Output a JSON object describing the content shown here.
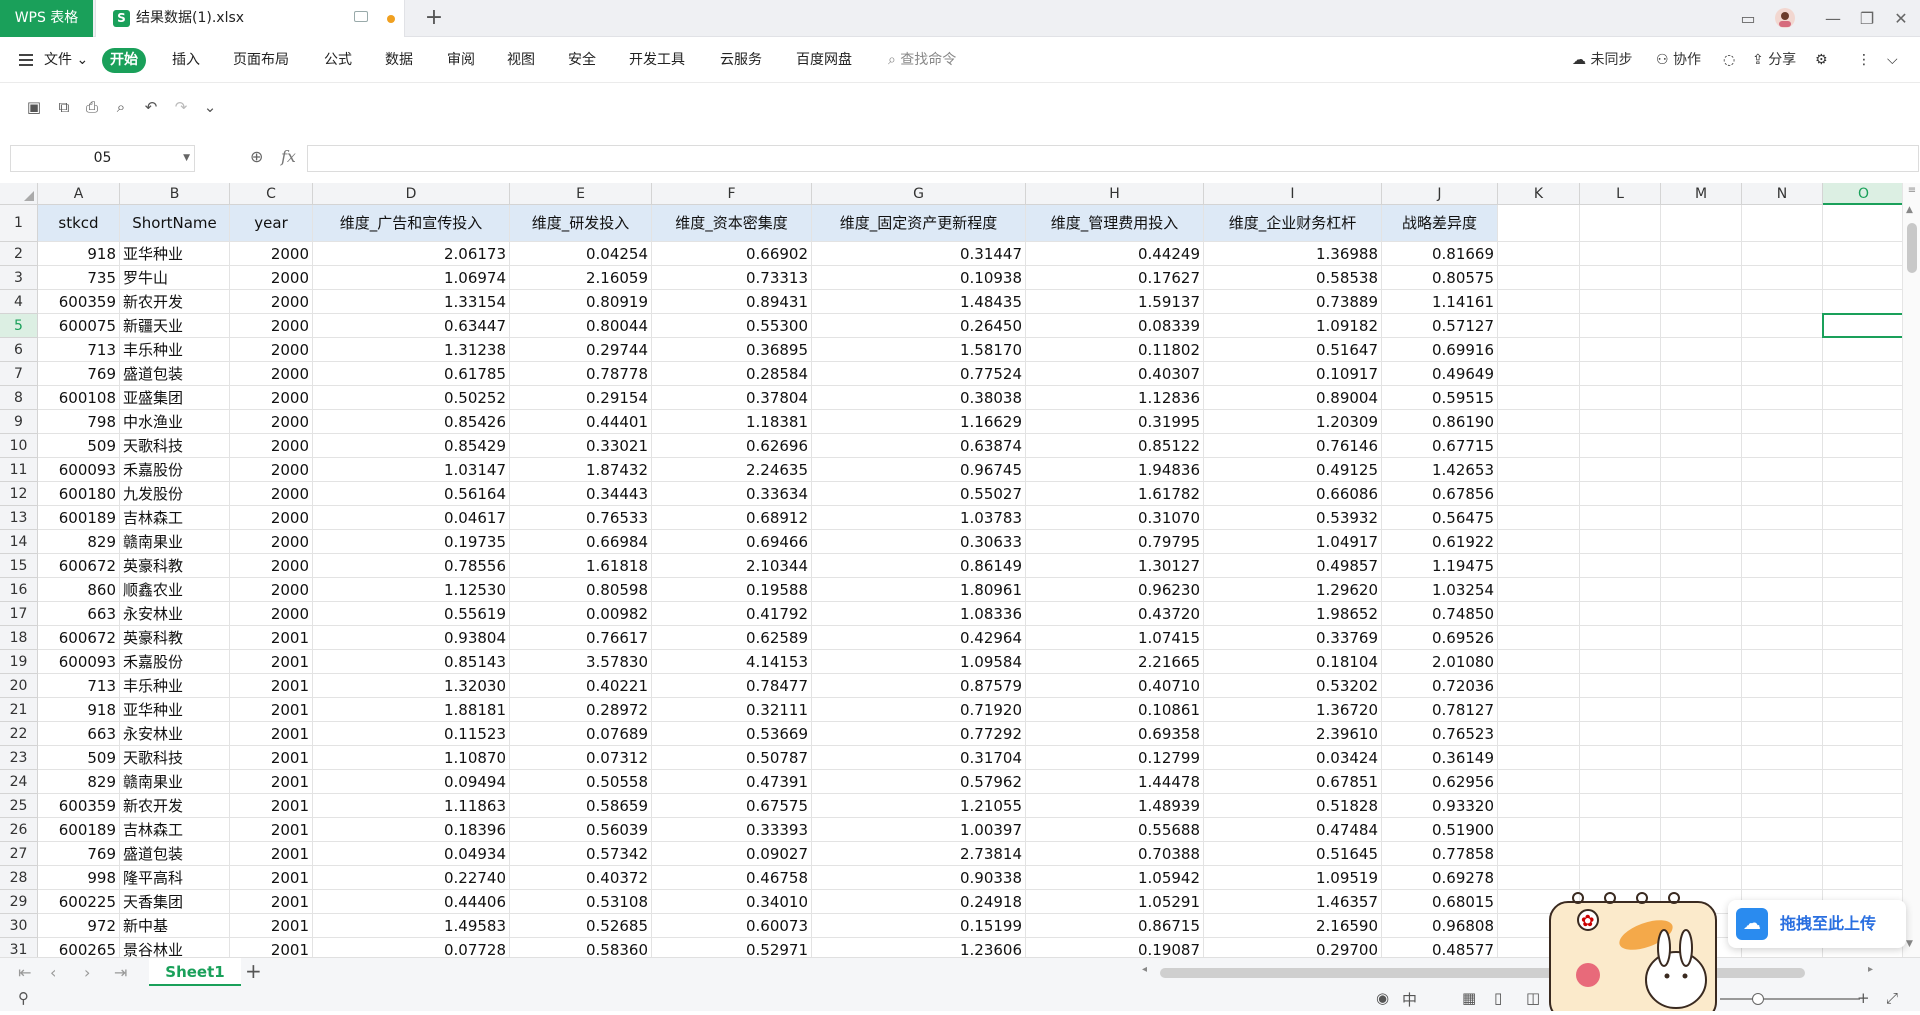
{
  "titlebar": {
    "app_name": "WPS 表格",
    "doc_icon": "S",
    "doc_name": "结果数据(1).xlsx",
    "new_tab": "+",
    "window_controls": [
      "minimize-icon",
      "restore-icon",
      "close-icon"
    ]
  },
  "menu": {
    "file": "文件",
    "active": "开始",
    "items": [
      "插入",
      "页面布局",
      "公式",
      "数据",
      "审阅",
      "视图",
      "安全",
      "开发工具",
      "云服务",
      "百度网盘"
    ],
    "search": "查找命令",
    "sync": "未同步",
    "collab": "协作",
    "share": "分享"
  },
  "quickbar": {
    "icons": [
      "save-icon",
      "save-as-icon",
      "print-icon",
      "print-preview-icon",
      "undo-icon",
      "redo-icon",
      "customize-icon"
    ]
  },
  "formula": {
    "namebox": "05",
    "fx": "fx",
    "value": ""
  },
  "sheet": {
    "columns": [
      "A",
      "B",
      "C",
      "D",
      "E",
      "F",
      "G",
      "H",
      "I",
      "J",
      "K",
      "L",
      "M",
      "N",
      "O"
    ],
    "selected_column": "O",
    "selected_row": "5",
    "header_row": [
      "stkcd",
      "ShortName",
      "year",
      "维度_广告和宣传投入",
      "维度_研发投入",
      "维度_资本密集度",
      "维度_固定资产更新程度",
      "维度_管理费用投入",
      "维度_企业财务杠杆",
      "战略差异度"
    ],
    "rows": [
      [
        "2",
        "918",
        "亚华种业",
        "2000",
        "2.06173",
        "0.04254",
        "0.66902",
        "0.31447",
        "0.44249",
        "1.36988",
        "0.81669"
      ],
      [
        "3",
        "735",
        "罗牛山",
        "2000",
        "1.06974",
        "2.16059",
        "0.73313",
        "0.10938",
        "0.17627",
        "0.58538",
        "0.80575"
      ],
      [
        "4",
        "600359",
        "新农开发",
        "2000",
        "1.33154",
        "0.80919",
        "0.89431",
        "1.48435",
        "1.59137",
        "0.73889",
        "1.14161"
      ],
      [
        "5",
        "600075",
        "新疆天业",
        "2000",
        "0.63447",
        "0.80044",
        "0.55300",
        "0.26450",
        "0.08339",
        "1.09182",
        "0.57127"
      ],
      [
        "6",
        "713",
        "丰乐种业",
        "2000",
        "1.31238",
        "0.29744",
        "0.36895",
        "1.58170",
        "0.11802",
        "0.51647",
        "0.69916"
      ],
      [
        "7",
        "769",
        "盛道包装",
        "2000",
        "0.61785",
        "0.78778",
        "0.28584",
        "0.77524",
        "0.40307",
        "0.10917",
        "0.49649"
      ],
      [
        "8",
        "600108",
        "亚盛集团",
        "2000",
        "0.50252",
        "0.29154",
        "0.37804",
        "0.38038",
        "1.12836",
        "0.89004",
        "0.59515"
      ],
      [
        "9",
        "798",
        "中水渔业",
        "2000",
        "0.85426",
        "0.44401",
        "1.18381",
        "1.16629",
        "0.31995",
        "1.20309",
        "0.86190"
      ],
      [
        "10",
        "509",
        "天歌科技",
        "2000",
        "0.85429",
        "0.33021",
        "0.62696",
        "0.63874",
        "0.85122",
        "0.76146",
        "0.67715"
      ],
      [
        "11",
        "600093",
        "禾嘉股份",
        "2000",
        "1.03147",
        "1.87432",
        "2.24635",
        "0.96745",
        "1.94836",
        "0.49125",
        "1.42653"
      ],
      [
        "12",
        "600180",
        "九发股份",
        "2000",
        "0.56164",
        "0.34443",
        "0.33634",
        "0.55027",
        "1.61782",
        "0.66086",
        "0.67856"
      ],
      [
        "13",
        "600189",
        "吉林森工",
        "2000",
        "0.04617",
        "0.76533",
        "0.68912",
        "1.03783",
        "0.31070",
        "0.53932",
        "0.56475"
      ],
      [
        "14",
        "829",
        "赣南果业",
        "2000",
        "0.19735",
        "0.66984",
        "0.69466",
        "0.30633",
        "0.79795",
        "1.04917",
        "0.61922"
      ],
      [
        "15",
        "600672",
        "英豪科教",
        "2000",
        "0.78556",
        "1.61818",
        "2.10344",
        "0.86149",
        "1.30127",
        "0.49857",
        "1.19475"
      ],
      [
        "16",
        "860",
        "顺鑫农业",
        "2000",
        "1.12530",
        "0.80598",
        "0.19588",
        "1.80961",
        "0.96230",
        "1.29620",
        "1.03254"
      ],
      [
        "17",
        "663",
        "永安林业",
        "2000",
        "0.55619",
        "0.00982",
        "0.41792",
        "1.08336",
        "0.43720",
        "1.98652",
        "0.74850"
      ],
      [
        "18",
        "600672",
        "英豪科教",
        "2001",
        "0.93804",
        "0.76617",
        "0.62589",
        "0.42964",
        "1.07415",
        "0.33769",
        "0.69526"
      ],
      [
        "19",
        "600093",
        "禾嘉股份",
        "2001",
        "0.85143",
        "3.57830",
        "4.14153",
        "1.09584",
        "2.21665",
        "0.18104",
        "2.01080"
      ],
      [
        "20",
        "713",
        "丰乐种业",
        "2001",
        "1.32030",
        "0.40221",
        "0.78477",
        "0.87579",
        "0.40710",
        "0.53202",
        "0.72036"
      ],
      [
        "21",
        "918",
        "亚华种业",
        "2001",
        "1.88181",
        "0.28972",
        "0.32111",
        "0.71920",
        "0.10861",
        "1.36720",
        "0.78127"
      ],
      [
        "22",
        "663",
        "永安林业",
        "2001",
        "0.11523",
        "0.07689",
        "0.53669",
        "0.77292",
        "0.69358",
        "2.39610",
        "0.76523"
      ],
      [
        "23",
        "509",
        "天歌科技",
        "2001",
        "1.10870",
        "0.07312",
        "0.50787",
        "0.31704",
        "0.12799",
        "0.03424",
        "0.36149"
      ],
      [
        "24",
        "829",
        "赣南果业",
        "2001",
        "0.09494",
        "0.50558",
        "0.47391",
        "0.57962",
        "1.44478",
        "0.67851",
        "0.62956"
      ],
      [
        "25",
        "600359",
        "新农开发",
        "2001",
        "1.11863",
        "0.58659",
        "0.67575",
        "1.21055",
        "1.48939",
        "0.51828",
        "0.93320"
      ],
      [
        "26",
        "600189",
        "吉林森工",
        "2001",
        "0.18396",
        "0.56039",
        "0.33393",
        "1.00397",
        "0.55688",
        "0.47484",
        "0.51900"
      ],
      [
        "27",
        "769",
        "盛道包装",
        "2001",
        "0.04934",
        "0.57342",
        "0.09027",
        "2.73814",
        "0.70388",
        "0.51645",
        "0.77858"
      ],
      [
        "28",
        "998",
        "隆平高科",
        "2001",
        "0.22740",
        "0.40372",
        "0.46758",
        "0.90338",
        "1.05942",
        "1.09519",
        "0.69278"
      ],
      [
        "29",
        "600225",
        "天香集团",
        "2001",
        "0.44406",
        "0.53108",
        "0.34010",
        "0.24918",
        "1.05291",
        "1.46357",
        "0.68015"
      ],
      [
        "30",
        "972",
        "新中基",
        "2001",
        "1.49583",
        "0.52685",
        "0.60073",
        "0.15199",
        "0.86715",
        "2.16590",
        "0.96808"
      ],
      [
        "31",
        "600265",
        "景谷林业",
        "2001",
        "0.07728",
        "0.58360",
        "0.52971",
        "1.23606",
        "0.19087",
        "0.29700",
        "0.48577"
      ]
    ]
  },
  "sheetbar": {
    "tab": "Sheet1",
    "add": "+"
  },
  "upload": {
    "label": "拖拽至此上传"
  }
}
